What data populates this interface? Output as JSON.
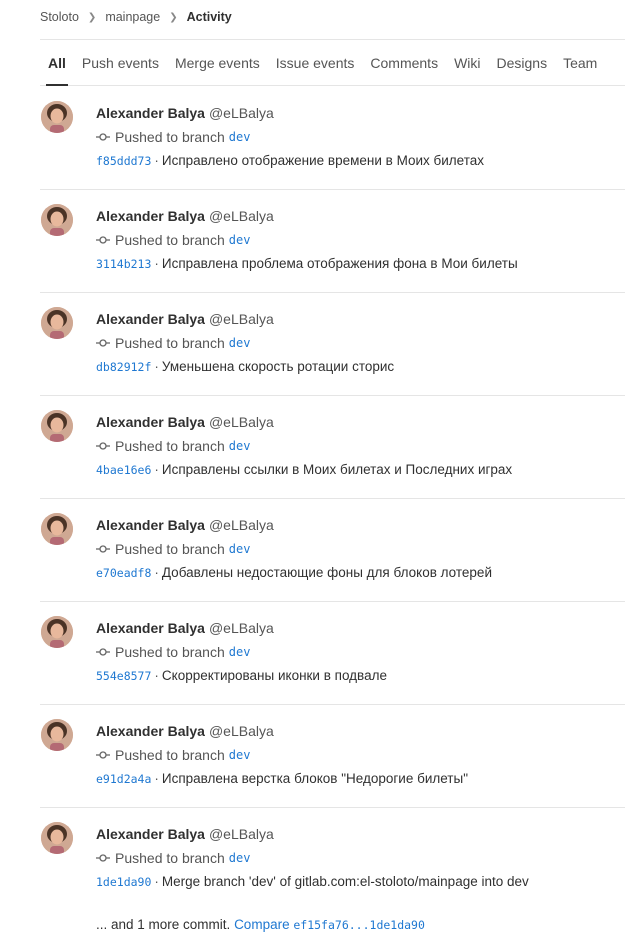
{
  "breadcrumb": {
    "group": "Stoloto",
    "project": "mainpage",
    "current": "Activity"
  },
  "tabs": [
    {
      "label": "All",
      "active": true
    },
    {
      "label": "Push events",
      "active": false
    },
    {
      "label": "Merge events",
      "active": false
    },
    {
      "label": "Issue events",
      "active": false
    },
    {
      "label": "Comments",
      "active": false
    },
    {
      "label": "Wiki",
      "active": false
    },
    {
      "label": "Designs",
      "active": false
    },
    {
      "label": "Team",
      "active": false
    }
  ],
  "events": [
    {
      "author": "Alexander Balya",
      "handle": "@eLBalya",
      "action": "Pushed to branch",
      "branch": "dev",
      "sha": "f85ddd73",
      "message": "Исправлено отображение времени в Моих билетах"
    },
    {
      "author": "Alexander Balya",
      "handle": "@eLBalya",
      "action": "Pushed to branch",
      "branch": "dev",
      "sha": "3114b213",
      "message": "Исправлена проблема отображения фона в Мои билеты"
    },
    {
      "author": "Alexander Balya",
      "handle": "@eLBalya",
      "action": "Pushed to branch",
      "branch": "dev",
      "sha": "db82912f",
      "message": "Уменьшена скорость ротации сторис"
    },
    {
      "author": "Alexander Balya",
      "handle": "@eLBalya",
      "action": "Pushed to branch",
      "branch": "dev",
      "sha": "4bae16e6",
      "message": "Исправлены ссылки в Моих билетах и Последних играх"
    },
    {
      "author": "Alexander Balya",
      "handle": "@eLBalya",
      "action": "Pushed to branch",
      "branch": "dev",
      "sha": "e70eadf8",
      "message": "Добавлены недостающие фоны для блоков лотерей"
    },
    {
      "author": "Alexander Balya",
      "handle": "@eLBalya",
      "action": "Pushed to branch",
      "branch": "dev",
      "sha": "554e8577",
      "message": "Скорректированы иконки в подвале"
    },
    {
      "author": "Alexander Balya",
      "handle": "@eLBalya",
      "action": "Pushed to branch",
      "branch": "dev",
      "sha": "e91d2a4a",
      "message": "Исправлена верстка блоков \"Недорогие билеты\""
    },
    {
      "author": "Alexander Balya",
      "handle": "@eLBalya",
      "action": "Pushed to branch",
      "branch": "dev",
      "sha": "1de1da90",
      "message": "Merge branch 'dev' of gitlab.com:el-stoloto/mainpage into dev",
      "more_text": "... and 1 more commit.",
      "compare_label": "Compare",
      "compare_range": "ef15fa76...1de1da90"
    }
  ]
}
